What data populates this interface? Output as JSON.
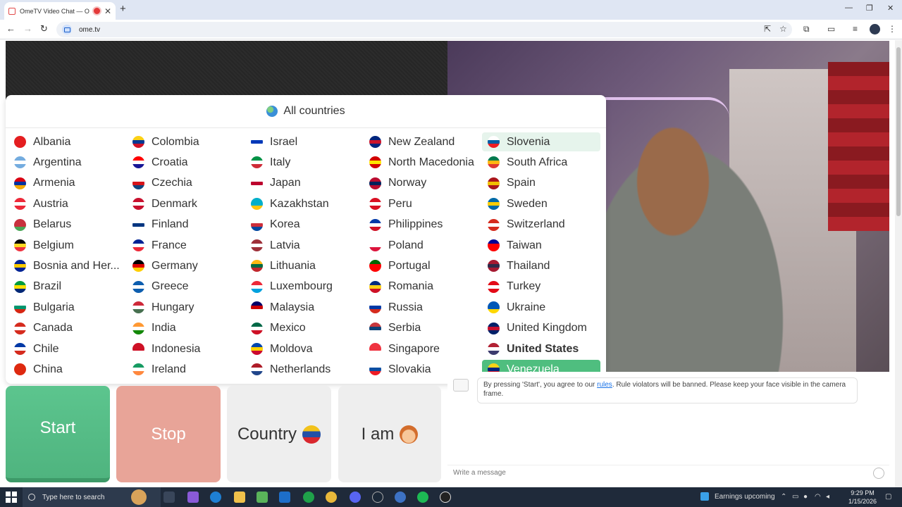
{
  "browser": {
    "tab_title": "OmeTV Video Chat — Ome",
    "tab_close": "✕",
    "new_tab": "+",
    "url": "ome.tv",
    "win_min": "—",
    "win_max": "❐",
    "win_close": "✕"
  },
  "panel": {
    "title": "All countries",
    "countries": [
      {
        "name": "Albania",
        "flag": [
          "#e41e20",
          "#e41e20",
          "#e41e20"
        ]
      },
      {
        "name": "Argentina",
        "flag": [
          "#74acdf",
          "#ffffff",
          "#74acdf"
        ]
      },
      {
        "name": "Armenia",
        "flag": [
          "#d90012",
          "#0033a0",
          "#f2a800"
        ]
      },
      {
        "name": "Austria",
        "flag": [
          "#ed2939",
          "#ffffff",
          "#ed2939"
        ]
      },
      {
        "name": "Belarus",
        "flag": [
          "#c8313e",
          "#c8313e",
          "#4aa657"
        ]
      },
      {
        "name": "Belgium",
        "flag": [
          "#000000",
          "#fdda24",
          "#ef3340"
        ]
      },
      {
        "name": "Bosnia and Her...",
        "flag": [
          "#002395",
          "#fecb00",
          "#002395"
        ]
      },
      {
        "name": "Brazil",
        "flag": [
          "#009c3b",
          "#ffdf00",
          "#002776"
        ]
      },
      {
        "name": "Bulgaria",
        "flag": [
          "#ffffff",
          "#00966e",
          "#d62612"
        ]
      },
      {
        "name": "Canada",
        "flag": [
          "#d52b1e",
          "#ffffff",
          "#d52b1e"
        ]
      },
      {
        "name": "Chile",
        "flag": [
          "#0039a6",
          "#ffffff",
          "#d52b1e"
        ]
      },
      {
        "name": "China",
        "flag": [
          "#de2910",
          "#de2910",
          "#de2910"
        ]
      },
      {
        "name": "Colombia",
        "flag": [
          "#fcd116",
          "#003893",
          "#ce1126"
        ]
      },
      {
        "name": "Croatia",
        "flag": [
          "#ff0000",
          "#ffffff",
          "#171796"
        ]
      },
      {
        "name": "Czechia",
        "flag": [
          "#ffffff",
          "#d7141a",
          "#11457e"
        ]
      },
      {
        "name": "Denmark",
        "flag": [
          "#c8102e",
          "#ffffff",
          "#c8102e"
        ]
      },
      {
        "name": "Finland",
        "flag": [
          "#ffffff",
          "#003580",
          "#ffffff"
        ]
      },
      {
        "name": "France",
        "flag": [
          "#002395",
          "#ffffff",
          "#ed2939"
        ]
      },
      {
        "name": "Germany",
        "flag": [
          "#000000",
          "#dd0000",
          "#ffce00"
        ]
      },
      {
        "name": "Greece",
        "flag": [
          "#0d5eaf",
          "#ffffff",
          "#0d5eaf"
        ]
      },
      {
        "name": "Hungary",
        "flag": [
          "#ce2939",
          "#ffffff",
          "#477050"
        ]
      },
      {
        "name": "India",
        "flag": [
          "#ff9933",
          "#ffffff",
          "#138808"
        ]
      },
      {
        "name": "Indonesia",
        "flag": [
          "#ce1126",
          "#ce1126",
          "#ffffff"
        ]
      },
      {
        "name": "Ireland",
        "flag": [
          "#169b62",
          "#ffffff",
          "#ff883e"
        ]
      },
      {
        "name": "Israel",
        "flag": [
          "#ffffff",
          "#0038b8",
          "#ffffff"
        ]
      },
      {
        "name": "Italy",
        "flag": [
          "#009246",
          "#ffffff",
          "#ce2b37"
        ]
      },
      {
        "name": "Japan",
        "flag": [
          "#ffffff",
          "#bc002d",
          "#ffffff"
        ]
      },
      {
        "name": "Kazakhstan",
        "flag": [
          "#00afca",
          "#00afca",
          "#fec50c"
        ]
      },
      {
        "name": "Korea",
        "flag": [
          "#ffffff",
          "#cd2e3a",
          "#0047a0"
        ]
      },
      {
        "name": "Latvia",
        "flag": [
          "#9e3039",
          "#ffffff",
          "#9e3039"
        ]
      },
      {
        "name": "Lithuania",
        "flag": [
          "#fdb913",
          "#006a44",
          "#c1272d"
        ]
      },
      {
        "name": "Luxembourg",
        "flag": [
          "#ed2939",
          "#ffffff",
          "#00a1de"
        ]
      },
      {
        "name": "Malaysia",
        "flag": [
          "#010066",
          "#cc0001",
          "#ffffff"
        ]
      },
      {
        "name": "Mexico",
        "flag": [
          "#006847",
          "#ffffff",
          "#ce1126"
        ]
      },
      {
        "name": "Moldova",
        "flag": [
          "#0046ae",
          "#ffd200",
          "#cc092f"
        ]
      },
      {
        "name": "Netherlands",
        "flag": [
          "#ae1c28",
          "#ffffff",
          "#21468b"
        ]
      },
      {
        "name": "New Zealand",
        "flag": [
          "#00247d",
          "#cc142b",
          "#00247d"
        ]
      },
      {
        "name": "North Macedonia",
        "flag": [
          "#d20000",
          "#ffe600",
          "#d20000"
        ]
      },
      {
        "name": "Norway",
        "flag": [
          "#ba0c2f",
          "#00205b",
          "#ba0c2f"
        ]
      },
      {
        "name": "Peru",
        "flag": [
          "#d91023",
          "#ffffff",
          "#d91023"
        ]
      },
      {
        "name": "Philippines",
        "flag": [
          "#0038a8",
          "#ffffff",
          "#ce1126"
        ]
      },
      {
        "name": "Poland",
        "flag": [
          "#ffffff",
          "#ffffff",
          "#dc143c"
        ]
      },
      {
        "name": "Portugal",
        "flag": [
          "#006600",
          "#ff0000",
          "#ff0000"
        ]
      },
      {
        "name": "Romania",
        "flag": [
          "#002b7f",
          "#fcd116",
          "#ce1126"
        ]
      },
      {
        "name": "Russia",
        "flag": [
          "#ffffff",
          "#0039a6",
          "#d52b1e"
        ]
      },
      {
        "name": "Serbia",
        "flag": [
          "#c6363c",
          "#0c4076",
          "#ffffff"
        ]
      },
      {
        "name": "Singapore",
        "flag": [
          "#ef3340",
          "#ef3340",
          "#ffffff"
        ]
      },
      {
        "name": "Slovakia",
        "flag": [
          "#ffffff",
          "#0b4ea2",
          "#ee1c25"
        ]
      },
      {
        "name": "Slovenia",
        "flag": [
          "#ffffff",
          "#005da4",
          "#ed1c24"
        ]
      },
      {
        "name": "South Africa",
        "flag": [
          "#007a4d",
          "#ffb612",
          "#de3831"
        ]
      },
      {
        "name": "Spain",
        "flag": [
          "#aa151b",
          "#f1bf00",
          "#aa151b"
        ]
      },
      {
        "name": "Sweden",
        "flag": [
          "#006aa7",
          "#fecc00",
          "#006aa7"
        ]
      },
      {
        "name": "Switzerland",
        "flag": [
          "#d52b1e",
          "#ffffff",
          "#d52b1e"
        ]
      },
      {
        "name": "Taiwan",
        "flag": [
          "#000095",
          "#fe0000",
          "#fe0000"
        ]
      },
      {
        "name": "Thailand",
        "flag": [
          "#a51931",
          "#2d2a4a",
          "#a51931"
        ]
      },
      {
        "name": "Turkey",
        "flag": [
          "#e30a17",
          "#ffffff",
          "#e30a17"
        ]
      },
      {
        "name": "Ukraine",
        "flag": [
          "#0057b7",
          "#0057b7",
          "#ffd700"
        ]
      },
      {
        "name": "United Kingdom",
        "flag": [
          "#012169",
          "#c8102e",
          "#012169"
        ]
      },
      {
        "name": "United States",
        "flag": [
          "#b22234",
          "#ffffff",
          "#3c3b6e"
        ]
      },
      {
        "name": "Venezuela",
        "flag": [
          "#fcd116",
          "#00247d",
          "#cf142b"
        ]
      }
    ],
    "hover_country": "Slovenia",
    "selected_country": "Venezuela",
    "bold_country": "United States"
  },
  "buttons": {
    "start": "Start",
    "stop": "Stop",
    "country": "Country",
    "iam": "I am"
  },
  "chat": {
    "msg_before": "By pressing 'Start', you agree to our ",
    "msg_link": "rules",
    "msg_after": ". Rule violators will be banned. Please keep your face visible in the camera frame.",
    "input_placeholder": "Write a message"
  },
  "taskbar": {
    "search_placeholder": "Type here to search",
    "earnings": "Earnings upcoming",
    "time": "9:29 PM",
    "date": "1/15/2026"
  }
}
